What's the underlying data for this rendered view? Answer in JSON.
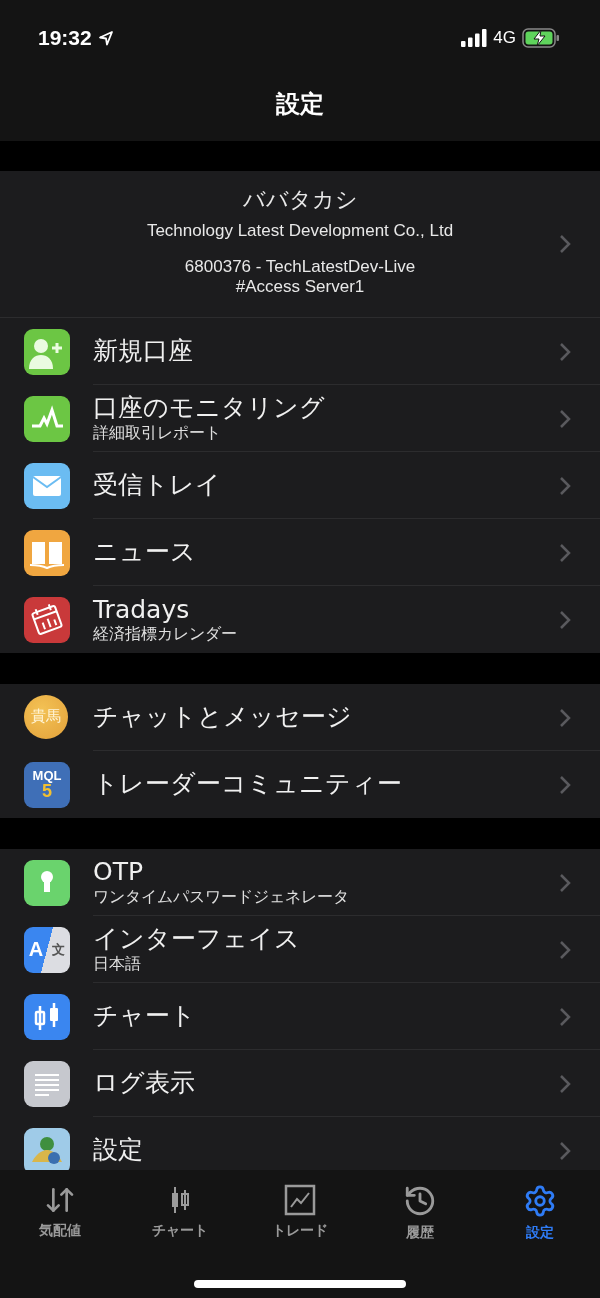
{
  "status_bar": {
    "time": "19:32",
    "network": "4G"
  },
  "nav": {
    "title": "設定"
  },
  "profile": {
    "name": "ババタカシ",
    "company": "Technology Latest Development Co., Ltd",
    "account": "6800376 - TechLatestDev-Live",
    "server": "#Access Server1"
  },
  "sections": [
    {
      "items": [
        {
          "kind": "add-user",
          "label": "新規口座"
        },
        {
          "kind": "monitor",
          "label": "口座のモニタリング",
          "subtitle": "詳細取引レポート"
        },
        {
          "kind": "mail",
          "label": "受信トレイ"
        },
        {
          "kind": "book",
          "label": "ニュース"
        },
        {
          "kind": "calendar",
          "label": "Tradays",
          "subtitle": "経済指標カレンダー"
        }
      ]
    },
    {
      "items": [
        {
          "kind": "avatar",
          "avatar_text": "貴馬",
          "label": "チャットとメッセージ"
        },
        {
          "kind": "mql",
          "logo_text": "MQL",
          "logo_digit": "5",
          "label": "トレーダーコミュニティー"
        }
      ]
    },
    {
      "items": [
        {
          "kind": "key",
          "label": "OTP",
          "subtitle": "ワンタイムパスワードジェネレータ"
        },
        {
          "kind": "language",
          "logo_text": "A",
          "logo_digit": "文",
          "label": "インターフェイス",
          "subtitle": "日本語"
        },
        {
          "kind": "candles",
          "label": "チャート"
        },
        {
          "kind": "lines",
          "label": "ログ表示"
        },
        {
          "kind": "app",
          "label": "設定"
        }
      ]
    }
  ],
  "tabs": [
    {
      "kind": "quotes",
      "label": "気配値",
      "selected": false
    },
    {
      "kind": "chart",
      "label": "チャート",
      "selected": false
    },
    {
      "kind": "trade",
      "label": "トレード",
      "selected": false
    },
    {
      "kind": "history",
      "label": "履歴",
      "selected": false
    },
    {
      "kind": "settings",
      "label": "設定",
      "selected": true
    }
  ]
}
